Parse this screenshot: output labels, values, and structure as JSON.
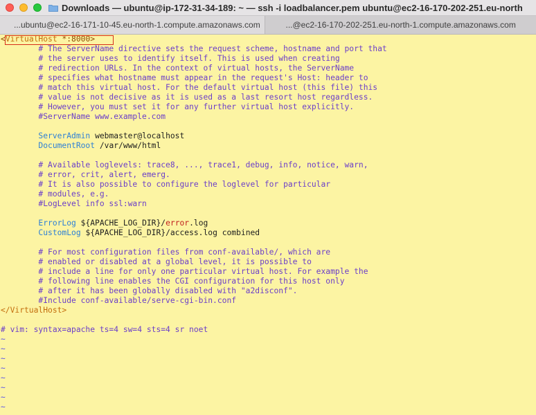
{
  "window": {
    "title": "Downloads — ubuntu@ip-172-31-34-189: ~ — ssh -i loadbalancer.pem ubuntu@ec2-16-170-202-251.eu-north"
  },
  "tabs": [
    {
      "label": "...ubuntu@ec2-16-171-10-45.eu-north-1.compute.amazonaws.com",
      "active": false
    },
    {
      "label": "...@ec2-16-170-202-251.eu-north-1.compute.amazonaws.com",
      "active": true
    }
  ],
  "editor": {
    "vhost_open_bracket": "<",
    "vhost_open_tag": "VirtualHost",
    "vhost_addr": "*:8000",
    "vhost_open_close": ">",
    "comment_block_1": [
      "        # The ServerName directive sets the request scheme, hostname and port that",
      "        # the server uses to identify itself. This is used when creating",
      "        # redirection URLs. In the context of virtual hosts, the ServerName",
      "        # specifies what hostname must appear in the request's Host: header to",
      "        # match this virtual host. For the default virtual host (this file) this",
      "        # value is not decisive as it is used as a last resort host regardless.",
      "        # However, you must set it for any further virtual host explicitly.",
      "        #ServerName www.example.com"
    ],
    "server_admin_key": "ServerAdmin",
    "server_admin_value": "webmaster@localhost",
    "document_root_key": "DocumentRoot",
    "document_root_value": "/var/www/html",
    "comment_block_2": [
      "        # Available loglevels: trace8, ..., trace1, debug, info, notice, warn,",
      "        # error, crit, alert, emerg.",
      "        # It is also possible to configure the loglevel for particular",
      "        # modules, e.g.",
      "        #LogLevel info ssl:warn"
    ],
    "error_log_key": "ErrorLog",
    "error_log_var": "${APACHE_LOG_DIR}",
    "error_log_slash": "/",
    "error_log_file": "error",
    "error_log_ext": ".log",
    "custom_log_key": "CustomLog",
    "custom_log_value": "${APACHE_LOG_DIR}/access.log combined",
    "comment_block_3": [
      "        # For most configuration files from conf-available/, which are",
      "        # enabled or disabled at a global level, it is possible to",
      "        # include a line for only one particular virtual host. For example the",
      "        # following line enables the CGI configuration for this host only",
      "        # after it has been globally disabled with \"a2disconf\".",
      "        #Include conf-available/serve-cgi-bin.conf"
    ],
    "vhost_close": "</VirtualHost>",
    "vim_modeline": "# vim: syntax=apache ts=4 sw=4 sts=4 sr noet",
    "tilde": "~"
  },
  "colors": {
    "background": "#fcf4a3",
    "comment": "#6b3ec9",
    "directive": "#2d7fd6",
    "tag": "#c36d0d",
    "error": "#c01d1d",
    "highlight_box": "#d62c1a"
  }
}
